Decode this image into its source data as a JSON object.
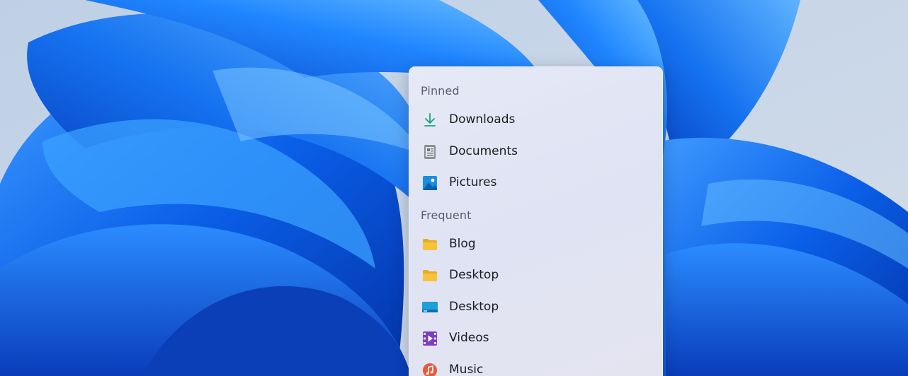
{
  "jump_list": {
    "sections": [
      {
        "label": "Pinned",
        "items": [
          {
            "label": "Downloads",
            "icon": "download-icon"
          },
          {
            "label": "Documents",
            "icon": "document-icon"
          },
          {
            "label": "Pictures",
            "icon": "pictures-icon"
          }
        ]
      },
      {
        "label": "Frequent",
        "items": [
          {
            "label": "Blog",
            "icon": "folder-icon"
          },
          {
            "label": "Desktop",
            "icon": "folder-icon"
          },
          {
            "label": "Desktop",
            "icon": "desktop-icon"
          },
          {
            "label": "Videos",
            "icon": "videos-icon"
          },
          {
            "label": "Music",
            "icon": "music-icon"
          }
        ]
      }
    ]
  },
  "colors": {
    "wallpaper_accent": "#0a5fe8",
    "download_accent": "#1aa37a",
    "folder_yellow": "#f6c33a",
    "video_purple": "#7b3fc4",
    "music_orange": "#e8593a"
  }
}
